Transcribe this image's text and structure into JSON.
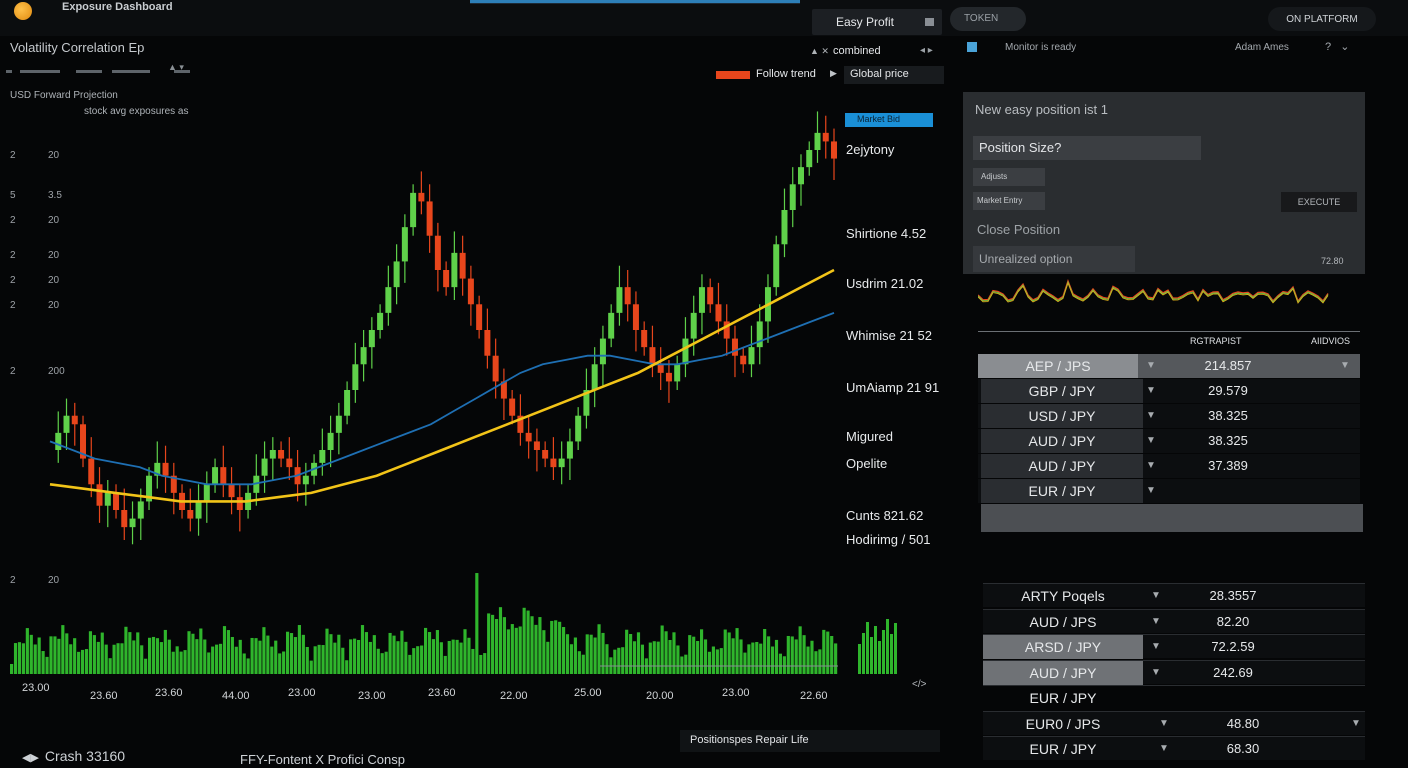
{
  "app": {
    "title": "Exposure Dashboard"
  },
  "top_bar": {
    "easy_profile_label": "Easy Profit",
    "tab_label": "TOKEN",
    "open_platform_label": "ON PLATFORM"
  },
  "chart": {
    "title": "Volatility Correlation Ep",
    "stat_line_1": "USD  Forward  Projection",
    "stat_line_2": "stock avg exposures as",
    "combined_label": "combined",
    "follow_label": "Follow trend",
    "global_label": "Global price",
    "blue_tag": "Market Bid",
    "side_labels": [
      "2ejytony",
      "Shirtione 4.52",
      "Usdrim 21.02",
      "Whimise 21 52",
      "UmAiamp 21 91",
      "Migured",
      "Opelite",
      "Cunts 821.62",
      "Hodirimg / 501"
    ],
    "y_labels": [
      {
        "a": "",
        "b": "",
        "top": 90
      },
      {
        "a": "2",
        "b": "20",
        "top": 150
      },
      {
        "a": "5",
        "b": "3.5",
        "top": 190
      },
      {
        "a": "2",
        "b": "20",
        "top": 215
      },
      {
        "a": "2",
        "b": "20",
        "top": 250
      },
      {
        "a": "2",
        "b": "20",
        "top": 275
      },
      {
        "a": "2",
        "b": "20",
        "top": 300
      },
      {
        "a": "2",
        "b": "200",
        "top": 366
      },
      {
        "a": "2",
        "b": "20",
        "top": 575
      }
    ],
    "x_ticks": [
      "23.00",
      "23.60",
      "23.60",
      "44.00",
      "23.00",
      "23.00",
      "23.60",
      "22.00",
      "25.00",
      "20.00",
      "23.00",
      "22.60"
    ],
    "footer_left": "Crash 33160",
    "footer_mid": "FFY-Fontent X Profici Consp",
    "footer_right": "Positionspes   Repair Life"
  },
  "chart_data": {
    "type": "candlestick",
    "title": "",
    "series": [
      {
        "name": "price",
        "values": [
          58,
          62,
          66,
          64,
          56,
          50,
          45,
          48,
          44,
          40,
          42,
          46,
          52,
          55,
          52,
          48,
          44,
          42,
          46,
          50,
          54,
          50,
          47,
          44,
          48,
          52,
          56,
          58,
          56,
          54,
          50,
          52,
          55,
          58,
          62,
          66,
          72,
          78,
          82,
          86,
          90,
          96,
          102,
          110,
          118,
          116,
          108,
          100,
          96,
          104,
          98,
          92,
          86,
          80,
          74,
          70,
          66,
          62,
          60,
          58,
          56,
          54,
          56,
          60,
          66,
          72,
          78,
          84,
          90,
          96,
          92,
          86,
          82,
          78,
          76,
          74,
          78,
          84,
          90,
          96,
          92,
          88,
          84,
          80,
          78,
          82,
          88,
          96,
          106,
          114,
          120,
          124,
          128,
          132,
          130,
          126
        ]
      },
      {
        "name": "moving-average-1",
        "values": [
          60,
          58,
          56,
          55,
          54,
          52,
          51,
          50,
          50,
          50,
          51,
          52,
          54,
          56,
          58,
          60,
          62,
          64,
          67,
          70,
          73,
          76,
          78,
          79,
          80,
          80,
          79,
          78,
          78,
          79,
          80,
          82,
          84,
          86,
          88,
          90
        ]
      },
      {
        "name": "moving-average-2",
        "values": [
          50,
          49,
          48,
          47,
          46,
          46,
          46,
          47,
          48,
          50,
          52,
          55,
          58,
          61,
          64,
          67,
          70,
          73,
          76,
          80,
          84,
          88,
          92,
          96,
          100
        ]
      }
    ]
  },
  "panel": {
    "header_title": "Monitor is ready",
    "user_label": "Adam Ames",
    "order_title": "New easy position ist 1",
    "position_field": "Position Size?",
    "adjust_btn": "Adjusts",
    "market_btn": "Market Entry",
    "execute_btn": "EXECUTE",
    "close_position": "Close Position",
    "unrealized": "Unrealized option",
    "unrealized_value": "72.80"
  },
  "table1": {
    "col1": "RGTRAPIST",
    "col2": "AIIDVIOS",
    "rows": [
      {
        "sym": "AEP / JPS",
        "val": "214.857",
        "hl": true
      },
      {
        "sym": "GBP / JPY",
        "val": "29.579",
        "hl": false
      },
      {
        "sym": "USD / JPY",
        "val": "38.325",
        "hl": false
      },
      {
        "sym": "AUD / JPY",
        "val": "38.325",
        "hl": false
      },
      {
        "sym": "AUD / JPY",
        "val": "37.389",
        "hl": false
      },
      {
        "sym": "EUR / JPY",
        "val": "",
        "hl": false
      }
    ]
  },
  "table2": {
    "rows": [
      {
        "sym": "ARTY Poqels",
        "val": "28.3557"
      },
      {
        "sym": "AUD / JPS",
        "val": "82.20"
      },
      {
        "sym": "ARSD / JPY",
        "val": "72.2.59"
      },
      {
        "sym": "AUD / JPY",
        "val": "242.69"
      },
      {
        "sym": "EUR / JPY",
        "val": ""
      },
      {
        "sym": "EUR0 / JPS",
        "val": "48.80"
      },
      {
        "sym": "EUR / JPY",
        "val": "68.30"
      }
    ]
  },
  "colors": {
    "up": "#5fd14a",
    "down": "#e8461c",
    "ma_blue": "#1e6fb3",
    "ma_yellow": "#f2c418",
    "volume": "#2fb52c"
  }
}
